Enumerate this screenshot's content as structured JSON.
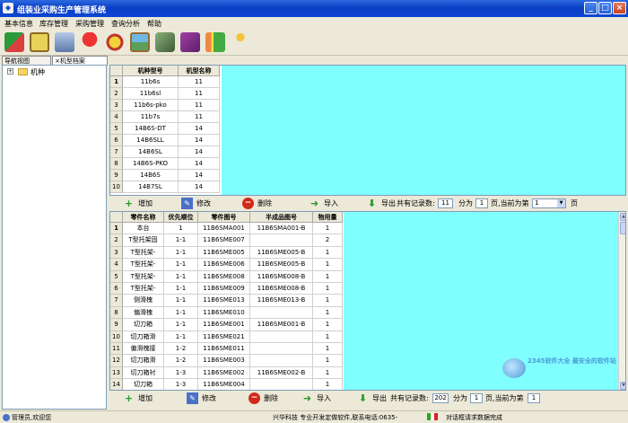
{
  "window": {
    "title": "组装业采购生产管理系统"
  },
  "menu": [
    "基本信息",
    "库存管理",
    "采购管理",
    "查询分析",
    "帮助"
  ],
  "toolbar": [
    "users-icon",
    "notebook-icon",
    "tools-icon",
    "umbrella-icon",
    "alarm-clock-icon",
    "picture-icon",
    "pda-icon",
    "book-icon",
    "gift-icon",
    "runner-icon"
  ],
  "tabs": {
    "nav": "导航视图",
    "model": "×机型档案"
  },
  "tree": {
    "root": "机种"
  },
  "top_grid": {
    "columns": [
      "机种型号",
      "机型名称"
    ],
    "rows": [
      [
        "11b6s",
        "11"
      ],
      [
        "11b6sl",
        "11"
      ],
      [
        "11b6s-pko",
        "11"
      ],
      [
        "11b7s",
        "11"
      ],
      [
        "14B6S-DT",
        "14"
      ],
      [
        "14B6SLL",
        "14"
      ],
      [
        "14B6SL",
        "14"
      ],
      [
        "14B6S-PKO",
        "14"
      ],
      [
        "14B6S",
        "14"
      ],
      [
        "14B7SL",
        "14"
      ]
    ],
    "row_numbers": [
      "1",
      "2",
      "3",
      "4",
      "5",
      "6",
      "7",
      "8",
      "9",
      "10"
    ]
  },
  "top_actions": {
    "add": "增加",
    "edit": "修改",
    "delete": "删除",
    "import": "导入",
    "export": "导出",
    "total_label": "共有记录数:",
    "total": "11",
    "split_label": "分为",
    "pages": "1",
    "page_label": "页,当前为第",
    "current_page": "1",
    "page_suffix": "页"
  },
  "bottom_grid": {
    "columns": [
      "零件名称",
      "优先顺位",
      "零件图号",
      "半成品图号",
      "物用量"
    ],
    "rows": [
      [
        "本台",
        "1",
        "11B6SMA001",
        "11B6SMA001-B",
        "1"
      ],
      [
        "T型托架固",
        "1-1",
        "11B6SME007",
        "",
        "2"
      ],
      [
        "T型托架-",
        "1-1",
        "11B6SME005",
        "11B6SME005-B",
        "1"
      ],
      [
        "T型托架-",
        "1-1",
        "11B6SME006",
        "11B6SME005-B",
        "1"
      ],
      [
        "T型托架-",
        "1-1",
        "11B6SME008",
        "11B6SME008-B",
        "1"
      ],
      [
        "T型托架-",
        "1-1",
        "11B6SME009",
        "11B6SME008-B",
        "1"
      ],
      [
        "侧滑槐",
        "1-1",
        "11B6SME013",
        "11B6SME013-B",
        "1"
      ],
      [
        "偏滑槐",
        "1-1",
        "11B6SME010",
        "",
        "1"
      ],
      [
        "切刀箱",
        "1-1",
        "11B6SME001",
        "11B6SME001-B",
        "1"
      ],
      [
        "切刀箱滑",
        "1-1",
        "11B6SME021",
        "",
        "1"
      ],
      [
        "偏滑槐接",
        "1-2",
        "11B6SME011",
        "",
        "1"
      ],
      [
        "切刀箱滑",
        "1-2",
        "11B6SME003",
        "",
        "1"
      ],
      [
        "切刀箱衬",
        "1-3",
        "11B6SME002",
        "11B6SME002-B",
        "1"
      ],
      [
        "切刀箱",
        "1-3",
        "11B6SME004",
        "",
        "1"
      ]
    ],
    "row_numbers": [
      "1",
      "2",
      "3",
      "4",
      "5",
      "6",
      "7",
      "8",
      "9",
      "10",
      "11",
      "12",
      "13",
      "14"
    ]
  },
  "bottom_actions": {
    "add": "增加",
    "edit": "修改",
    "delete": "删除",
    "import": "导入",
    "export": "导出",
    "total_label": "共有记录数:",
    "total": "202",
    "split_label": "分为",
    "pages": "1",
    "page_label": "页,当前为第",
    "current_page": "1"
  },
  "status": {
    "user": "管理员,欢迎您",
    "company": "兴华科技 专业开发定做软件,联系电话:0635-",
    "message": "对话框请求数据完成"
  },
  "watermark": "2345软件大全 最安全的软件站",
  "colors": {
    "accent": "#80ffff",
    "title": "#0a3fc4"
  }
}
